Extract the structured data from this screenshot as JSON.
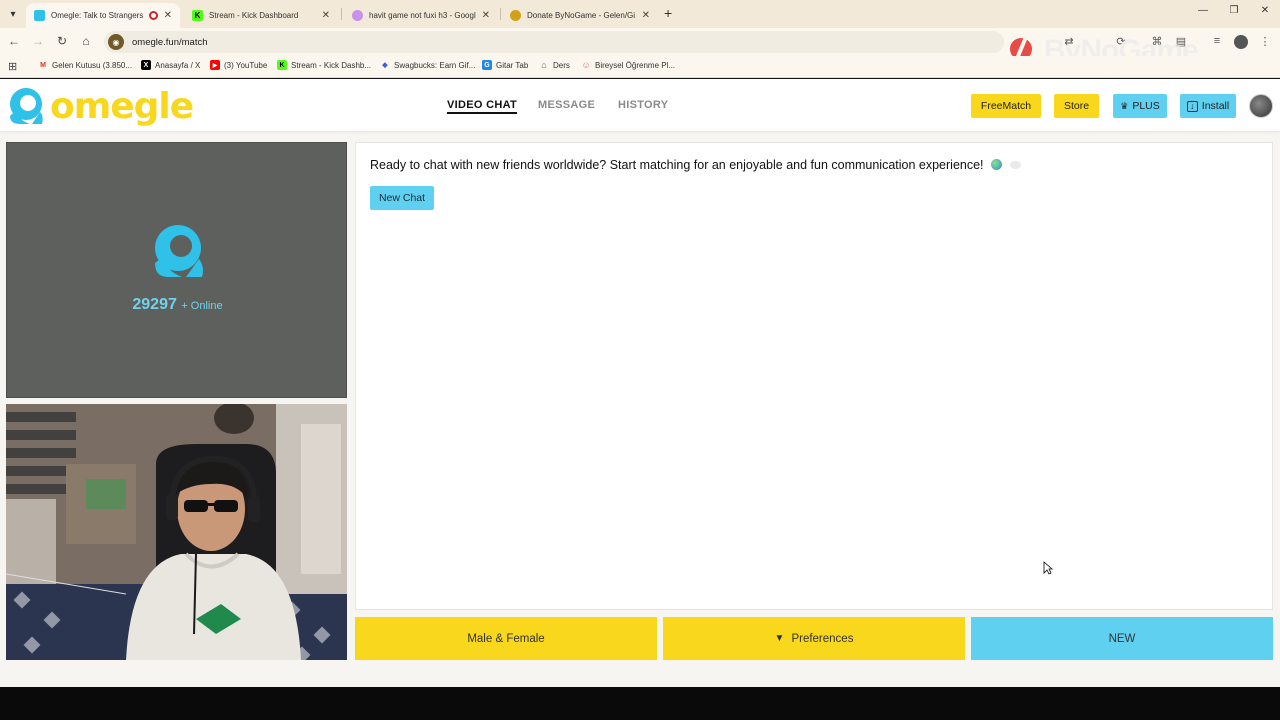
{
  "browser": {
    "tabs": [
      {
        "label": "Omegle: Talk to Strangers w",
        "favicon_color": "#2fc1e8",
        "active": true,
        "recording": true
      },
      {
        "label": "Stream - Kick Dashboard",
        "favicon_color": "#53fc18",
        "favicon_text": "K"
      },
      {
        "label": "havit game not fuxi h3 - Googl",
        "favicon_color": "#c792ea"
      },
      {
        "label": "Donate ByNoGame - Gelen/Gi",
        "favicon_color": "#d4a017"
      }
    ],
    "address": "omegle.fun/match",
    "bookmarks": [
      {
        "label": "Gelen Kutusu (3.850...",
        "icon": "gmail-icon",
        "color": "#d93025",
        "glyph": "M"
      },
      {
        "label": "Anasayfa / X",
        "icon": "x-icon",
        "color": "#000000",
        "glyph": "X"
      },
      {
        "label": "(3) YouTube",
        "icon": "youtube-icon",
        "color": "#ff0000",
        "glyph": "▶"
      },
      {
        "label": "Stream - Kick Dashb...",
        "icon": "kick-icon",
        "color": "#53fc18",
        "glyph": "K"
      },
      {
        "label": "Swagbucks: Earn Gif...",
        "icon": "swagbucks-icon",
        "color": "#3a5fd8",
        "glyph": "◆"
      },
      {
        "label": "Gitar Tab",
        "icon": "gitar-tab-icon",
        "color": "#1e88e5",
        "glyph": "G"
      },
      {
        "label": "Ders",
        "icon": "home-icon",
        "color": "#666666",
        "glyph": "⌂"
      },
      {
        "label": "Bireysel Öğrenme Pl...",
        "icon": "learning-icon",
        "color": "#e57373",
        "glyph": "☺"
      }
    ],
    "watermark": "ByNoGame"
  },
  "site": {
    "logo_text": "omegle",
    "nav": [
      {
        "label": "VIDEO CHAT",
        "active": true
      },
      {
        "label": "MESSAGE",
        "active": false
      },
      {
        "label": "HISTORY",
        "active": false
      }
    ],
    "buttons": {
      "freematch": "FreeMatch",
      "store": "Store",
      "plus": "PLUS",
      "install": "Install"
    },
    "online_count": "29297",
    "online_label": "+ Online",
    "chat_message": "Ready to chat with new friends worldwide? Start matching for an enjoyable and fun communication experience!",
    "new_chat_label": "New Chat",
    "bottom": {
      "gender": "Male & Female",
      "preferences": "Preferences",
      "new": "NEW"
    }
  },
  "colors": {
    "brand_yellow": "#f9d71c",
    "brand_blue": "#5fd0f0",
    "online_blue": "#6fd3ee"
  }
}
